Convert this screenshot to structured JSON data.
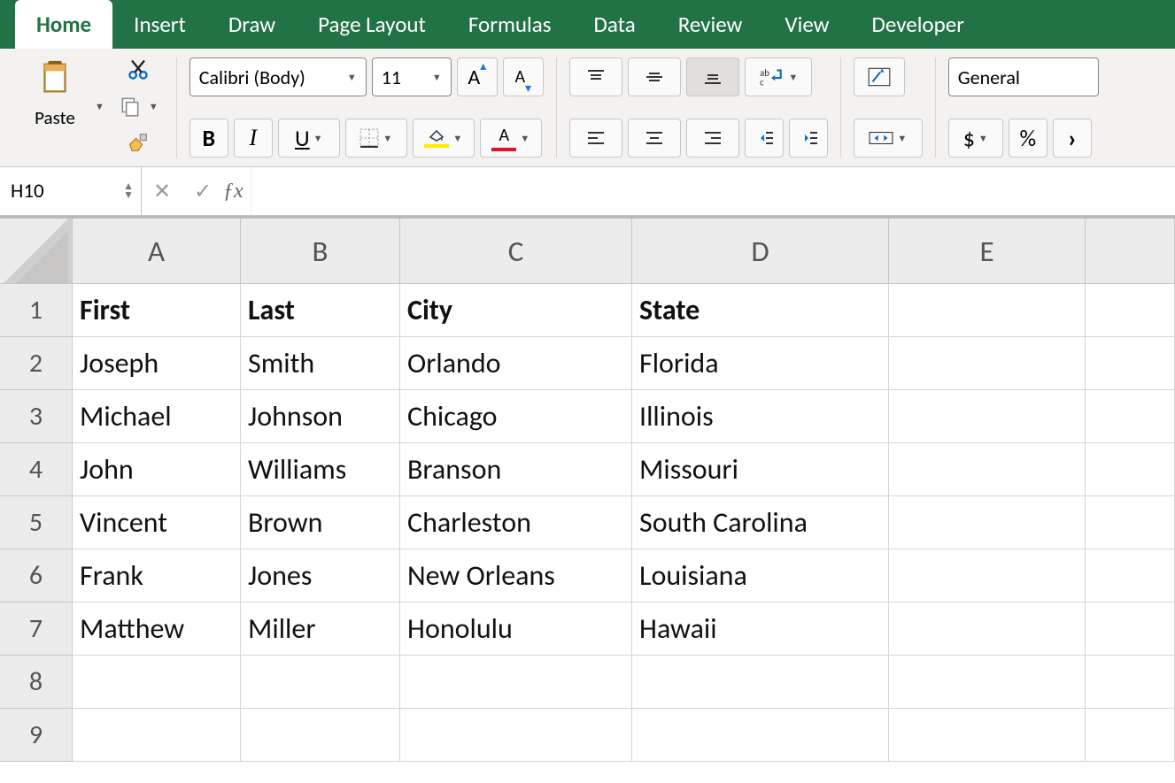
{
  "tabs": [
    "Home",
    "Insert",
    "Draw",
    "Page Layout",
    "Formulas",
    "Data",
    "Review",
    "View",
    "Developer"
  ],
  "active_tab": "Home",
  "ribbon": {
    "paste_label": "Paste",
    "font_name": "Calibri (Body)",
    "font_size": "11",
    "number_format": "General"
  },
  "formula_bar": {
    "name_box": "H10",
    "formula": ""
  },
  "grid": {
    "columns": [
      "A",
      "B",
      "C",
      "D",
      "E"
    ],
    "row_numbers": [
      1,
      2,
      3,
      4,
      5,
      6,
      7,
      8,
      9
    ],
    "headers": [
      "First",
      "Last",
      "City",
      "State"
    ],
    "rows": [
      [
        "Joseph",
        "Smith",
        "Orlando",
        "Florida"
      ],
      [
        "Michael",
        "Johnson",
        "Chicago",
        "Illinois"
      ],
      [
        "John",
        "Williams",
        "Branson",
        "Missouri"
      ],
      [
        "Vincent",
        "Brown",
        "Charleston",
        "South Carolina"
      ],
      [
        "Frank",
        "Jones",
        "New Orleans",
        "Louisiana"
      ],
      [
        "Matthew",
        "Miller",
        "Honolulu",
        "Hawaii"
      ]
    ]
  }
}
